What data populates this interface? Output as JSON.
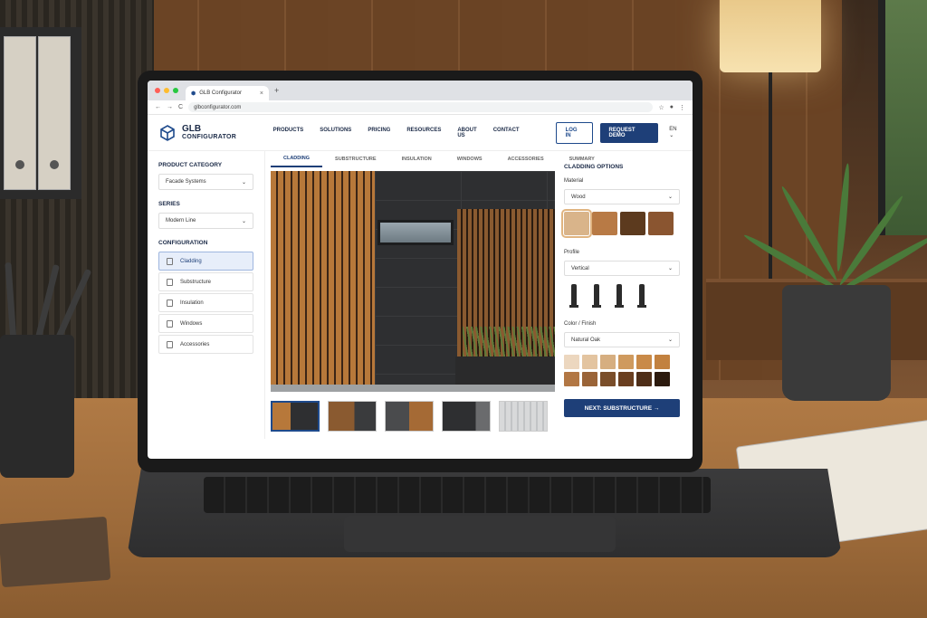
{
  "browser": {
    "tab_title": "GLB Configurator",
    "tab_close": "×",
    "new_tab": "+",
    "url": "glbconfigurator.com",
    "nav_back": "←",
    "nav_forward": "→",
    "nav_reload": "C"
  },
  "site": {
    "logo_line1": "GLB",
    "logo_line2": "CONFIGURATOR",
    "menu": [
      "PRODUCTS",
      "SOLUTIONS",
      "PRICING",
      "RESOURCES",
      "ABOUT US",
      "CONTACT"
    ],
    "login_label": "LOG IN",
    "demo_label": "REQUEST DEMO",
    "language": "EN ⌄"
  },
  "sidebar": {
    "product_category_heading": "PRODUCT CATEGORY",
    "product_category_value": "Facade Systems",
    "series_heading": "SERIES",
    "series_value": "Modern Line",
    "configuration_heading": "CONFIGURATION",
    "items": [
      {
        "label": "Cladding",
        "active": true
      },
      {
        "label": "Substructure",
        "active": false
      },
      {
        "label": "Insulation",
        "active": false
      },
      {
        "label": "Windows",
        "active": false
      },
      {
        "label": "Accessories",
        "active": false
      }
    ]
  },
  "main": {
    "tabs": [
      {
        "label": "CLADDING",
        "active": true
      },
      {
        "label": "SUBSTRUCTURE",
        "active": false
      },
      {
        "label": "INSULATION",
        "active": false
      },
      {
        "label": "WINDOWS",
        "active": false
      },
      {
        "label": "ACCESSORIES",
        "active": false
      },
      {
        "label": "SUMMARY",
        "active": false
      }
    ],
    "thumbnails_selected_index": 0
  },
  "options": {
    "heading": "CLADDING OPTIONS",
    "material_label": "Material",
    "material_value": "Wood",
    "material_swatches": [
      "#d9b48a",
      "#b87a45",
      "#5c3a1e",
      "#8a5530"
    ],
    "material_selected_index": 0,
    "profile_label": "Profile",
    "profile_value": "Vertical",
    "color_label": "Color / Finish",
    "color_value": "Natural Oak",
    "color_swatches": [
      "#ecd7bf",
      "#e3c4a0",
      "#d6ae80",
      "#cf9a5e",
      "#c98a48",
      "#c2813f",
      "#b27744",
      "#9a6438",
      "#7a4e2a",
      "#6a3f20",
      "#4e2e18",
      "#2c1a0e"
    ],
    "next_label": "NEXT: SUBSTRUCTURE →"
  },
  "colors": {
    "brand_navy": "#1e3f78",
    "active_bg": "#e7eefa"
  },
  "icons": [
    "cube-logo-icon",
    "chevron-down-icon",
    "layer-icon",
    "arrow-right-icon"
  ]
}
